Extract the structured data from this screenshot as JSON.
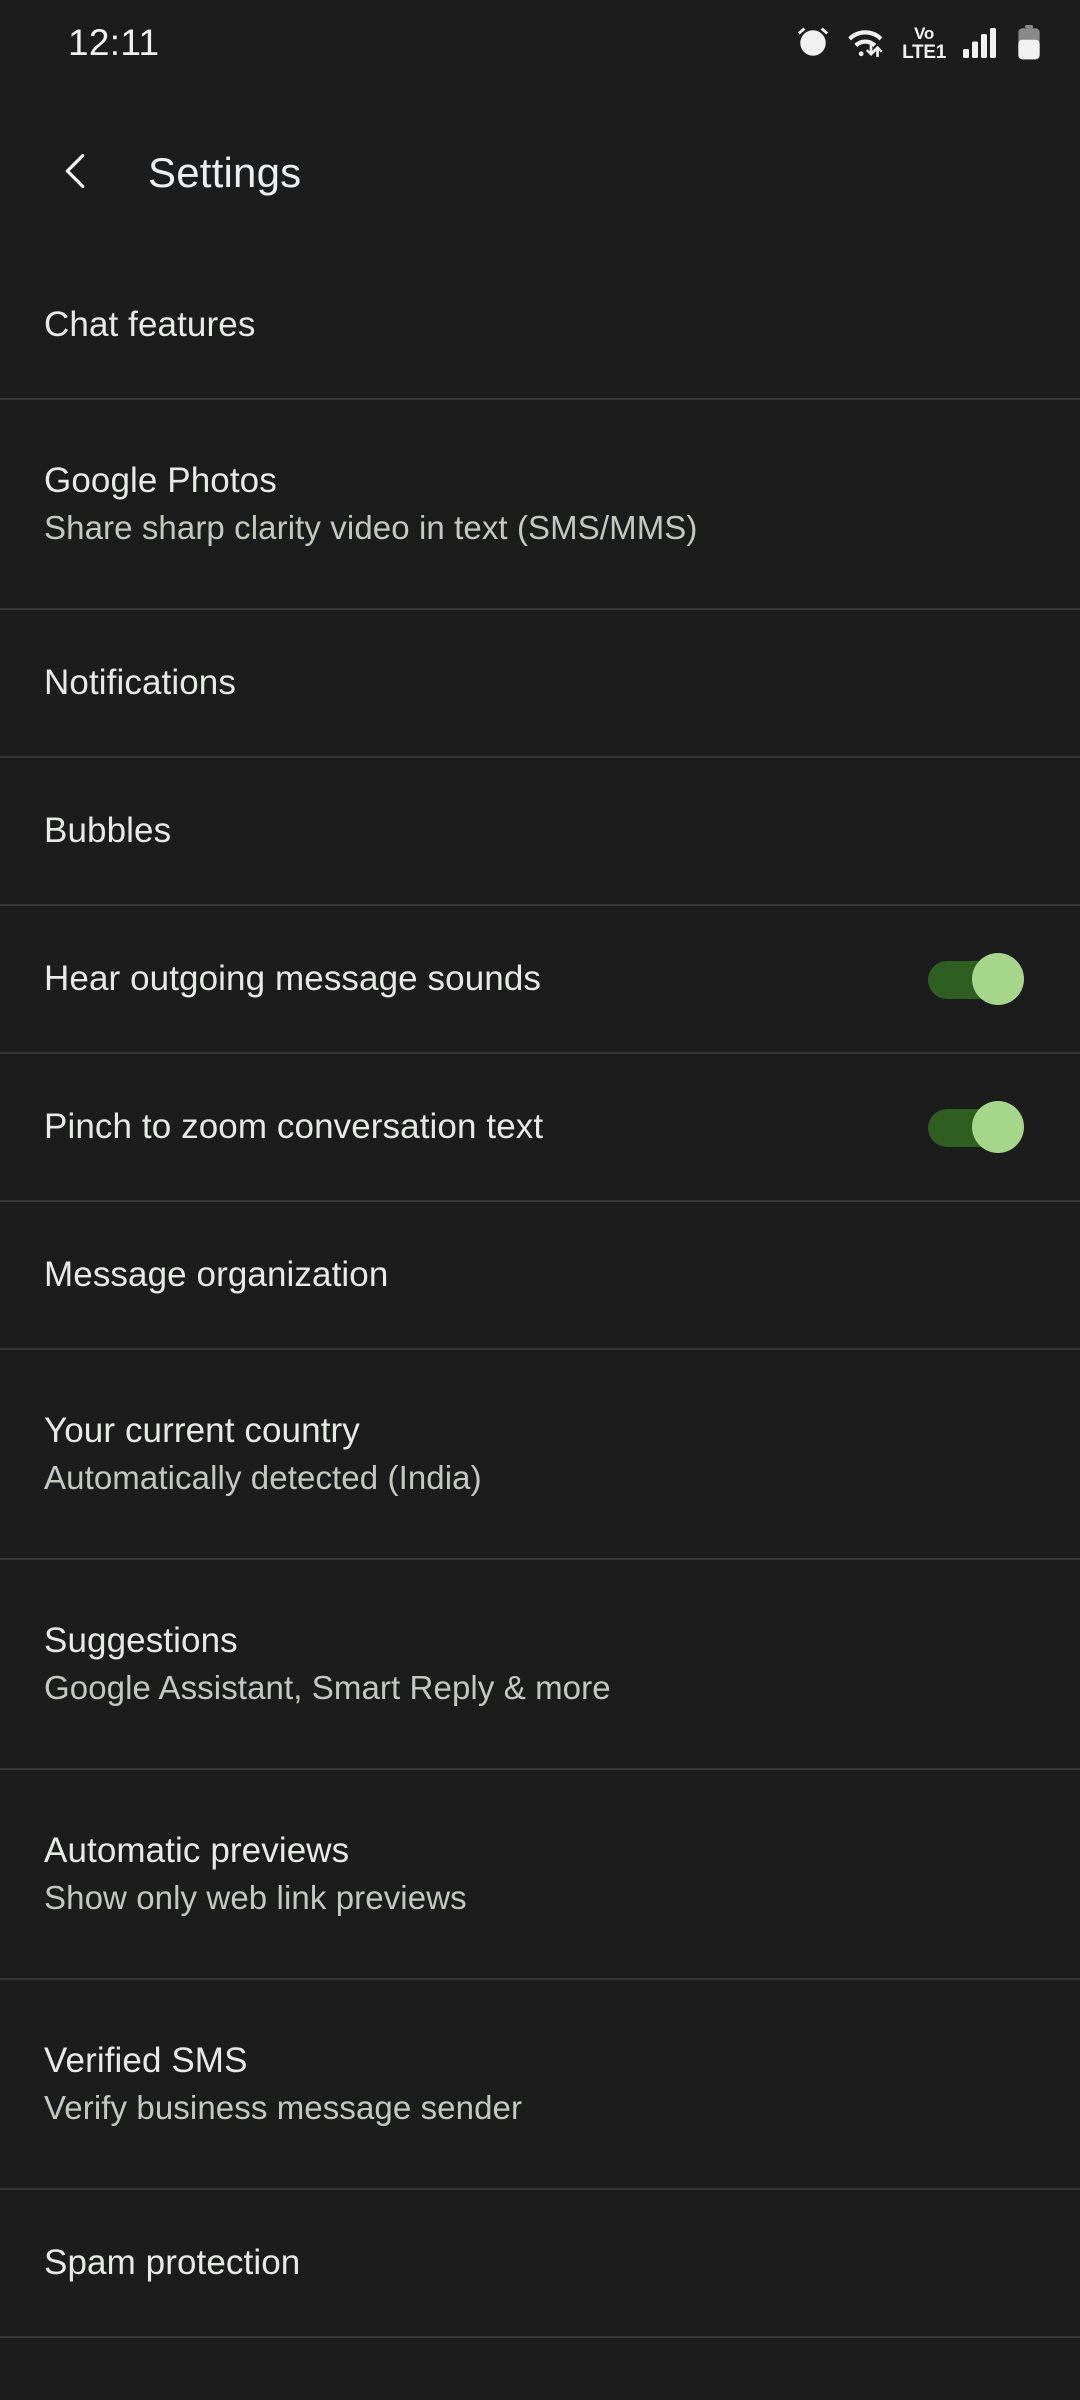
{
  "statusbar": {
    "time": "12:11",
    "icons": [
      "alarm-icon",
      "wifi-icon",
      "volte-icon",
      "signal-icon",
      "battery-icon"
    ],
    "volte_top": "Vo",
    "volte_bottom": "LTE1"
  },
  "header": {
    "back_icon": "chevron-left-icon",
    "title": "Settings"
  },
  "colors": {
    "background": "#1c1c1c",
    "divider": "#343434",
    "title_text": "#e8eae8",
    "subtitle_text": "#c3c9c1",
    "switch_track_on": "#2f5e21",
    "switch_thumb_on": "#a5d68a"
  },
  "list": {
    "items": [
      {
        "title": "Chat features",
        "subtitle": null,
        "control": null
      },
      {
        "title": "Google Photos",
        "subtitle": "Share sharp clarity video in text (SMS/MMS)",
        "control": null
      },
      {
        "title": "Notifications",
        "subtitle": null,
        "control": null
      },
      {
        "title": "Bubbles",
        "subtitle": null,
        "control": null
      },
      {
        "title": "Hear outgoing message sounds",
        "subtitle": null,
        "control": "switch",
        "checked": true
      },
      {
        "title": "Pinch to zoom conversation text",
        "subtitle": null,
        "control": "switch",
        "checked": true
      },
      {
        "title": "Message organization",
        "subtitle": null,
        "control": null
      },
      {
        "title": "Your current country",
        "subtitle": "Automatically detected (India)",
        "control": null
      },
      {
        "title": "Suggestions",
        "subtitle": "Google Assistant, Smart Reply & more",
        "control": null
      },
      {
        "title": "Automatic previews",
        "subtitle": "Show only web link previews",
        "control": null
      },
      {
        "title": "Verified SMS",
        "subtitle": "Verify business message sender",
        "control": null
      },
      {
        "title": "Spam protection",
        "subtitle": null,
        "control": null
      }
    ]
  }
}
